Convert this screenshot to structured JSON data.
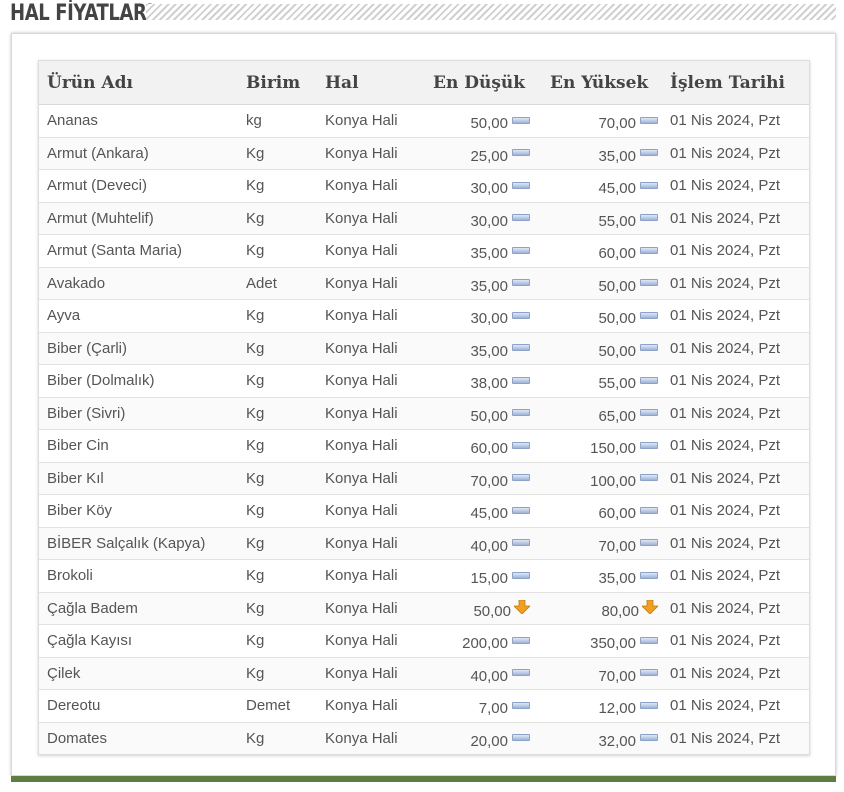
{
  "header": {
    "title": "HAL FİYATLARI"
  },
  "table": {
    "columns": [
      "Ürün Adı",
      "Birim",
      "Hal",
      "En Düşük",
      "En Yüksek",
      "İşlem Tarihi"
    ],
    "rows": [
      {
        "urun": "Ananas",
        "birim": "kg",
        "hal": "Konya Hali",
        "min": "50,00",
        "min_trend": "flat-icon",
        "max": "70,00",
        "max_trend": "flat-icon",
        "tarih": "01 Nis 2024, Pzt"
      },
      {
        "urun": "Armut (Ankara)",
        "birim": "Kg",
        "hal": "Konya Hali",
        "min": "25,00",
        "min_trend": "flat-icon",
        "max": "35,00",
        "max_trend": "flat-icon",
        "tarih": "01 Nis 2024, Pzt"
      },
      {
        "urun": "Armut (Deveci)",
        "birim": "Kg",
        "hal": "Konya Hali",
        "min": "30,00",
        "min_trend": "flat-icon",
        "max": "45,00",
        "max_trend": "flat-icon",
        "tarih": "01 Nis 2024, Pzt"
      },
      {
        "urun": "Armut (Muhtelif)",
        "birim": "Kg",
        "hal": "Konya Hali",
        "min": "30,00",
        "min_trend": "flat-icon",
        "max": "55,00",
        "max_trend": "flat-icon",
        "tarih": "01 Nis 2024, Pzt"
      },
      {
        "urun": "Armut (Santa Maria)",
        "birim": "Kg",
        "hal": "Konya Hali",
        "min": "35,00",
        "min_trend": "flat-icon",
        "max": "60,00",
        "max_trend": "flat-icon",
        "tarih": "01 Nis 2024, Pzt"
      },
      {
        "urun": "Avakado",
        "birim": "Adet",
        "hal": "Konya Hali",
        "min": "35,00",
        "min_trend": "flat-icon",
        "max": "50,00",
        "max_trend": "flat-icon",
        "tarih": "01 Nis 2024, Pzt"
      },
      {
        "urun": "Ayva",
        "birim": "Kg",
        "hal": "Konya Hali",
        "min": "30,00",
        "min_trend": "flat-icon",
        "max": "50,00",
        "max_trend": "flat-icon",
        "tarih": "01 Nis 2024, Pzt"
      },
      {
        "urun": "Biber (Çarli)",
        "birim": "Kg",
        "hal": "Konya Hali",
        "min": "35,00",
        "min_trend": "flat-icon",
        "max": "50,00",
        "max_trend": "flat-icon",
        "tarih": "01 Nis 2024, Pzt"
      },
      {
        "urun": "Biber (Dolmalık)",
        "birim": "Kg",
        "hal": "Konya Hali",
        "min": "38,00",
        "min_trend": "flat-icon",
        "max": "55,00",
        "max_trend": "flat-icon",
        "tarih": "01 Nis 2024, Pzt"
      },
      {
        "urun": "Biber (Sivri)",
        "birim": "Kg",
        "hal": "Konya Hali",
        "min": "50,00",
        "min_trend": "flat-icon",
        "max": "65,00",
        "max_trend": "flat-icon",
        "tarih": "01 Nis 2024, Pzt"
      },
      {
        "urun": "Biber Cin",
        "birim": "Kg",
        "hal": "Konya Hali",
        "min": "60,00",
        "min_trend": "flat-icon",
        "max": "150,00",
        "max_trend": "flat-icon",
        "tarih": "01 Nis 2024, Pzt"
      },
      {
        "urun": "Biber Kıl",
        "birim": "Kg",
        "hal": "Konya Hali",
        "min": "70,00",
        "min_trend": "flat-icon",
        "max": "100,00",
        "max_trend": "flat-icon",
        "tarih": "01 Nis 2024, Pzt"
      },
      {
        "urun": "Biber Köy",
        "birim": "Kg",
        "hal": "Konya Hali",
        "min": "45,00",
        "min_trend": "flat-icon",
        "max": "60,00",
        "max_trend": "flat-icon",
        "tarih": "01 Nis 2024, Pzt"
      },
      {
        "urun": "BİBER Salçalık (Kapya)",
        "birim": "Kg",
        "hal": "Konya Hali",
        "min": "40,00",
        "min_trend": "flat-icon",
        "max": "70,00",
        "max_trend": "flat-icon",
        "tarih": "01 Nis 2024, Pzt"
      },
      {
        "urun": "Brokoli",
        "birim": "Kg",
        "hal": "Konya Hali",
        "min": "15,00",
        "min_trend": "flat-icon",
        "max": "35,00",
        "max_trend": "flat-icon",
        "tarih": "01 Nis 2024, Pzt"
      },
      {
        "urun": "Çağla Badem",
        "birim": "Kg",
        "hal": "Konya Hali",
        "min": "50,00",
        "min_trend": "down-arrow-icon",
        "max": "80,00",
        "max_trend": "down-arrow-icon",
        "tarih": "01 Nis 2024, Pzt"
      },
      {
        "urun": "Çağla Kayısı",
        "birim": "Kg",
        "hal": "Konya Hali",
        "min": "200,00",
        "min_trend": "flat-icon",
        "max": "350,00",
        "max_trend": "flat-icon",
        "tarih": "01 Nis 2024, Pzt"
      },
      {
        "urun": "Çilek",
        "birim": "Kg",
        "hal": "Konya Hali",
        "min": "40,00",
        "min_trend": "flat-icon",
        "max": "70,00",
        "max_trend": "flat-icon",
        "tarih": "01 Nis 2024, Pzt"
      },
      {
        "urun": "Dereotu",
        "birim": "Demet",
        "hal": "Konya Hali",
        "min": "7,00",
        "min_trend": "flat-icon",
        "max": "12,00",
        "max_trend": "flat-icon",
        "tarih": "01 Nis 2024, Pzt"
      },
      {
        "urun": "Domates",
        "birim": "Kg",
        "hal": "Konya Hali",
        "min": "20,00",
        "min_trend": "flat-icon",
        "max": "32,00",
        "max_trend": "flat-icon",
        "tarih": "01 Nis 2024, Pzt"
      }
    ]
  },
  "colors": {
    "accent_bar": "#5e7d45",
    "header_text": "#444444",
    "down_arrow": "#f0a020"
  }
}
